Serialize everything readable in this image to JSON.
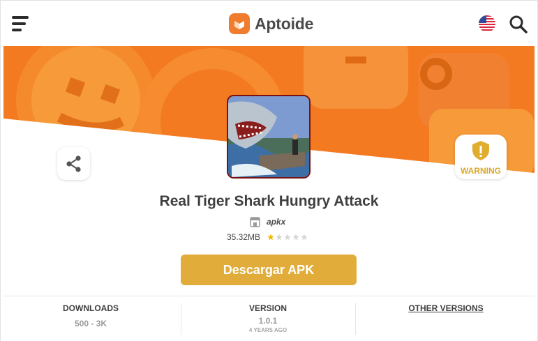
{
  "header": {
    "brand": "Aptoide",
    "menu_icon": "hamburger-menu-icon",
    "language_icon": "us-flag-icon",
    "search_icon": "search-icon"
  },
  "app": {
    "title": "Real Tiger Shark Hungry Attack",
    "developer": "apkx",
    "size": "35.32MB",
    "rating_stars": 1,
    "rating_max": 5
  },
  "badges": {
    "warning_label": "WARNING"
  },
  "actions": {
    "download_label": "Descargar APK",
    "share_icon": "share-icon"
  },
  "stats": {
    "downloads_label": "DOWNLOADS",
    "downloads_value": "500 - 3K",
    "version_label": "VERSION",
    "version_value": "1.0.1",
    "version_date": "4 YEARS AGO",
    "other_versions_label": "OTHER VERSIONS"
  },
  "colors": {
    "brand_orange": "#f47a22",
    "download_button": "#e1ac39",
    "warning_yellow": "#d9a72a",
    "icon_border": "#7a1111",
    "star_filled": "#f5b400",
    "star_empty": "#d6d6d6"
  }
}
